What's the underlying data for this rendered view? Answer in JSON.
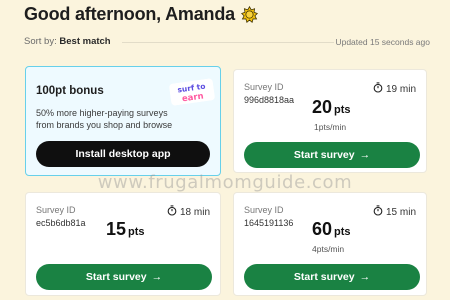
{
  "header": {
    "greeting": "Good afternoon, Amanda",
    "sort_label": "Sort by:",
    "sort_value": "Best match",
    "updated": "Updated 15 seconds ago"
  },
  "bonus": {
    "title": "100pt bonus",
    "description": "50% more higher-paying surveys from brands you shop and browse",
    "badge_line1": "surf to",
    "badge_line2": "earn",
    "button_label": "Install desktop app"
  },
  "surveys": [
    {
      "id_label": "Survey ID",
      "id": "996d8818aa",
      "time": "19 min",
      "points": "20",
      "points_unit": "pts",
      "rate": "1pts/min",
      "button_label": "Start survey",
      "button_arrow": "→"
    },
    {
      "id_label": "Survey ID",
      "id": "ec5b6db81a",
      "time": "18 min",
      "points": "15",
      "points_unit": "pts",
      "rate": "",
      "button_label": "Start survey",
      "button_arrow": "→"
    },
    {
      "id_label": "Survey ID",
      "id": "1645191136",
      "time": "15 min",
      "points": "60",
      "points_unit": "pts",
      "rate": "4pts/min",
      "button_label": "Start survey",
      "button_arrow": "→"
    }
  ],
  "watermark": "www.frugalmomguide.com",
  "colors": {
    "accent_green": "#1a8243",
    "bonus_border": "#67d0ea",
    "background": "#fbf4dd"
  },
  "icons": {
    "greeting": "sun-icon",
    "time": "stopwatch-icon",
    "button": "arrow-right-icon"
  }
}
